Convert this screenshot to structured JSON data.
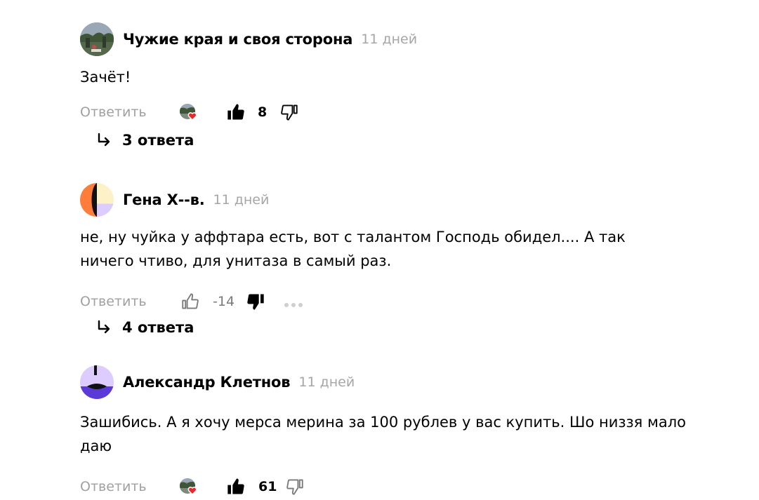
{
  "comments": [
    {
      "author": "Чужие края и своя сторона",
      "date": "11 дней",
      "text": "Зачёт!",
      "reply_label": "Ответить",
      "score": "8",
      "replies_label": "3 ответа",
      "avatar": "photo-avatar",
      "liked_by_author": true,
      "user_vote": "like"
    },
    {
      "author": "Гена Х--в.",
      "date": "11 дней",
      "text": "не, ну чуйка у аффтара есть, вот с талантом Господь обидел.... А так ничего чтиво, для унитаза в самый раз.",
      "reply_label": "Ответить",
      "score": "-14",
      "replies_label": "4 ответа",
      "avatar": "geometric-avatar-orange",
      "liked_by_author": false,
      "user_vote": "dislike"
    },
    {
      "author": "Александр Клетнов",
      "date": "11 дней",
      "text": "Зашибись. А я хочу мерса мерина за 100 рублев у вас купить. Шо низзя мало даю",
      "reply_label": "Ответить",
      "score": "61",
      "avatar": "geometric-avatar-purple",
      "liked_by_author": true,
      "user_vote": "like"
    }
  ],
  "icons": {
    "like": "thumbs-up-icon",
    "dislike": "thumbs-down-icon",
    "reply_arrow": "reply-arrow-icon",
    "more": "more-dots-icon",
    "heart": "heart-icon"
  },
  "colors": {
    "muted": "#a6a6a6",
    "heart": "#e8282b",
    "avatar_orange": "#ff7d3a",
    "avatar_cream": "#fdf1c7",
    "avatar_lavender": "#dcccff",
    "avatar_purple": "#5b3ad8"
  }
}
